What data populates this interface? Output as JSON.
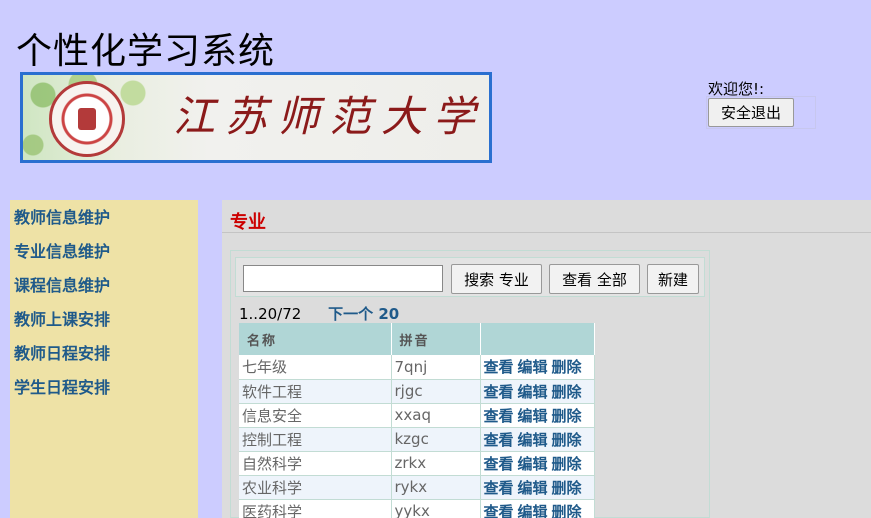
{
  "header": {
    "app_title": "个性化学习系统",
    "banner_text": "江苏师范大学",
    "welcome_label": "欢迎您!:",
    "logout_label": "安全退出"
  },
  "sidebar": {
    "items": [
      {
        "label": "教师信息维护"
      },
      {
        "label": "专业信息维护"
      },
      {
        "label": "课程信息维护"
      },
      {
        "label": "教师上课安排"
      },
      {
        "label": "教师日程安排"
      },
      {
        "label": "学生日程安排"
      }
    ]
  },
  "main": {
    "heading": "专业",
    "search": {
      "value": "",
      "placeholder": ""
    },
    "buttons": {
      "search": "搜索 专业",
      "all": "查看 全部",
      "new": "新建"
    },
    "pager": {
      "range": "1..20/72",
      "next": "下一个 20"
    },
    "table": {
      "columns": [
        "名称",
        "拼音",
        ""
      ],
      "actions": [
        "查看",
        "编辑",
        "删除"
      ],
      "rows": [
        {
          "name": "七年级",
          "pinyin": "7qnj"
        },
        {
          "name": "软件工程",
          "pinyin": "rjgc"
        },
        {
          "name": "信息安全",
          "pinyin": "xxaq"
        },
        {
          "name": "控制工程",
          "pinyin": "kzgc"
        },
        {
          "name": "自然科学",
          "pinyin": "zrkx"
        },
        {
          "name": "农业科学",
          "pinyin": "rykx"
        },
        {
          "name": "医药科学",
          "pinyin": "yykx"
        }
      ]
    }
  },
  "colors": {
    "page_bg": "#ccccff",
    "sidebar_bg": "#eee2a6",
    "link": "#1f5a8a",
    "heading_red": "#cc0000",
    "table_header_bg": "#b0d6d6"
  }
}
